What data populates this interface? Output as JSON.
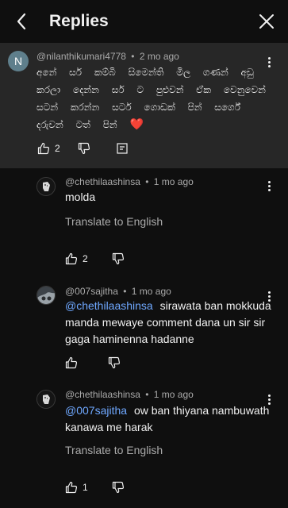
{
  "header": {
    "title": "Replies",
    "back_icon": "chevron-left-icon",
    "close_icon": "close-icon"
  },
  "parent_comment": {
    "avatar_letter": "N",
    "author": "@nilanthikumari4778",
    "separator": "•",
    "time": "2 mo ago",
    "text": "අනේ සර් කම්බි සිමෙන්ති මිල ගණන් අඩු කරලා දෙන්න සර් ට පුළුවන් ඒක වෙනුවෙන් සටන් කරන්න සර්ට ගොඩක් පින් සර්ගේ දරුවන් ටත් පින්",
    "emoji": "❤️",
    "like_count": "2"
  },
  "replies": [
    {
      "author": "@chethilaashinsa",
      "separator": "•",
      "time": "1 mo ago",
      "mention": "",
      "text": "molda",
      "translate": "Translate to English",
      "like_count": "2"
    },
    {
      "author": "@007sajitha",
      "separator": "•",
      "time": "1 mo ago",
      "mention": "@chethilaashinsa",
      "text": "sirawata ban mokkuda manda mewaye comment dana un sir sir gaga haminenna hadanne",
      "translate": "",
      "like_count": ""
    },
    {
      "author": "@chethilaashinsa",
      "separator": "•",
      "time": "1 mo ago",
      "mention": "@007sajitha",
      "text": "ow ban thiyana nambuwath kanawa me harak",
      "translate": "Translate to English",
      "like_count": "1"
    }
  ],
  "colors": {
    "background": "#0f0f0f",
    "highlight": "#272727",
    "mention": "#6fa8ff",
    "secondary_text": "#aaaaaa"
  }
}
